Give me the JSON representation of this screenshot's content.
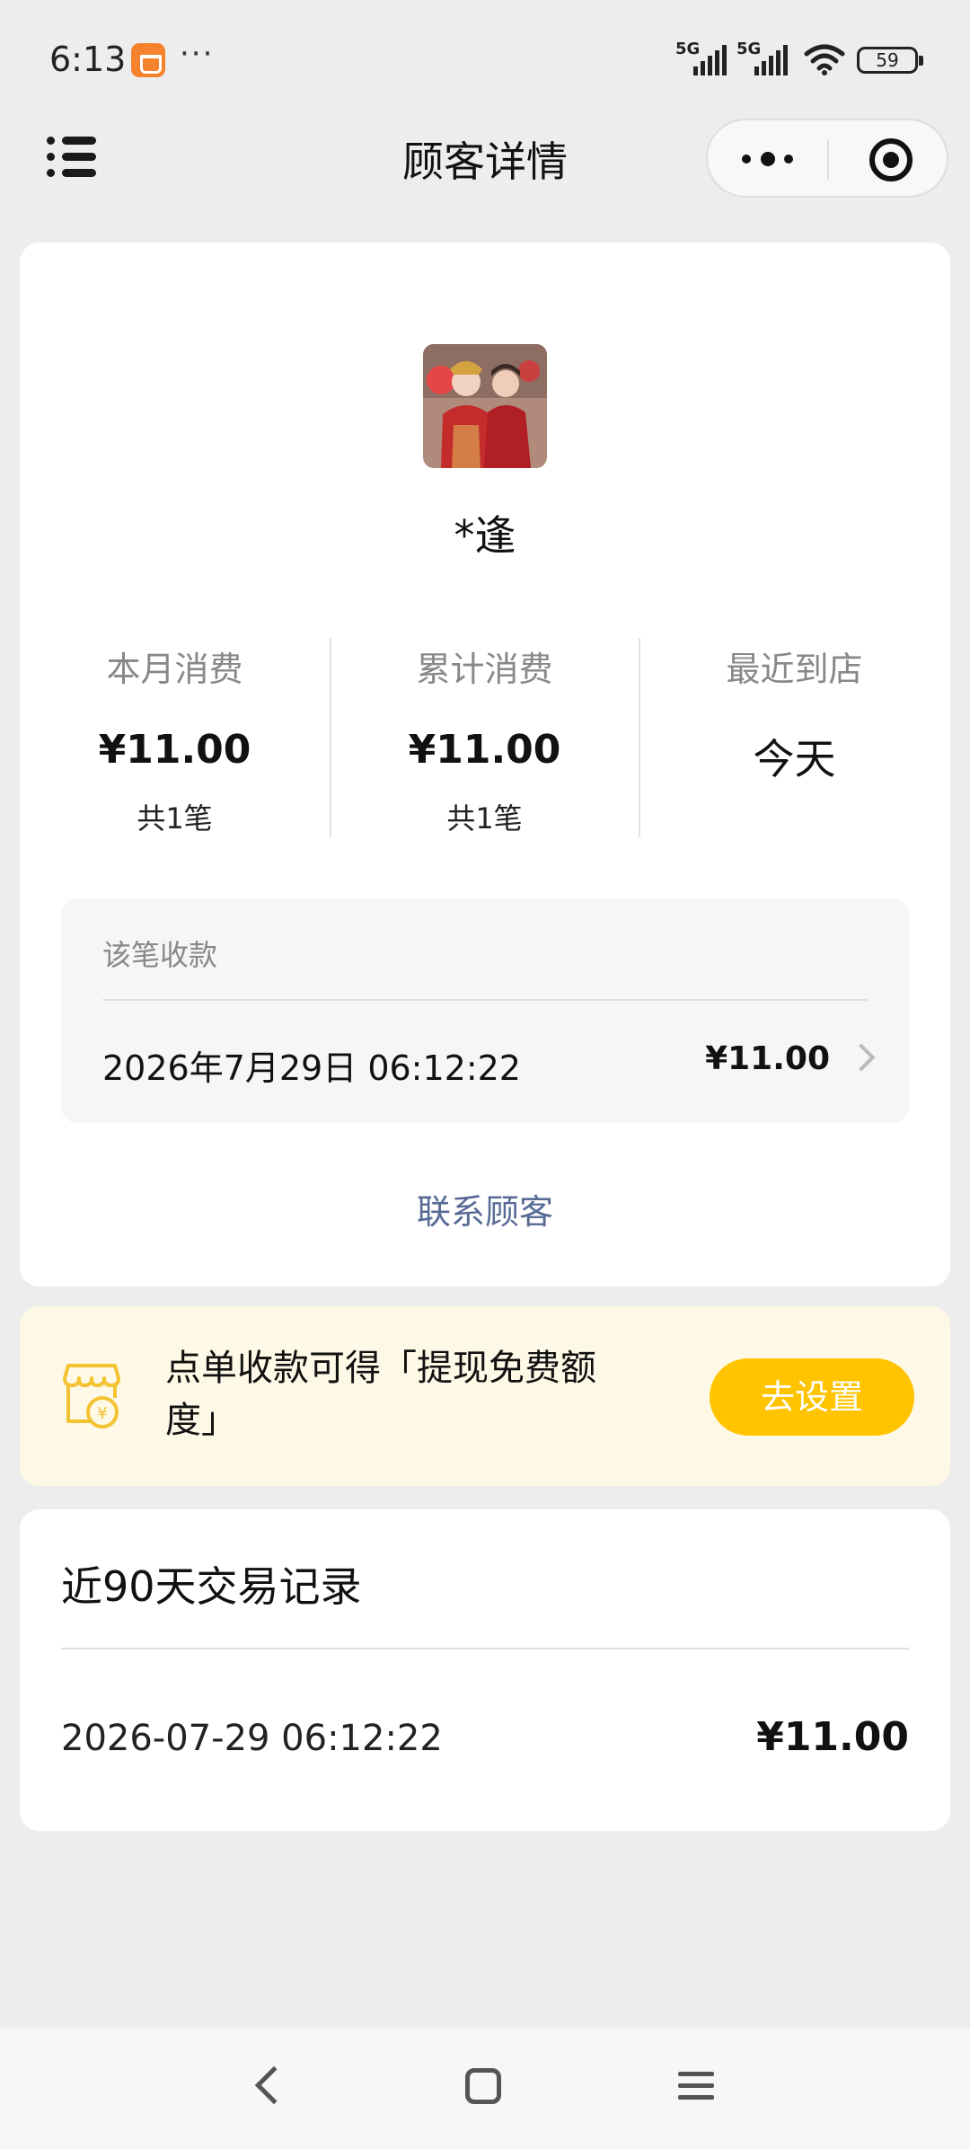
{
  "status_bar": {
    "time": "6:13",
    "dots": "···",
    "signal1": "5G",
    "signal2": "5G",
    "battery": "59"
  },
  "header": {
    "title": "顾客详情"
  },
  "profile": {
    "name": "*逢"
  },
  "stats": {
    "monthly": {
      "label": "本月消费",
      "value": "¥11.00",
      "count": "共1笔"
    },
    "total": {
      "label": "累计消费",
      "value": "¥11.00",
      "count": "共1笔"
    },
    "recent": {
      "label": "最近到店",
      "value": "今天"
    }
  },
  "receipt": {
    "label": "该笔收款",
    "date": "2026年7月29日 06:12:22",
    "amount": "¥11.00"
  },
  "contact_label": "联系顾客",
  "promo": {
    "text": "点单收款可得「提现免费额度」",
    "button": "去设置"
  },
  "records": {
    "title": "近90天交易记录",
    "items": [
      {
        "date": "2026-07-29 06:12:22",
        "amount": "¥11.00"
      }
    ]
  },
  "colors": {
    "link": "#576b95",
    "accent": "#ffc300",
    "promo_bg": "#fef9e6"
  }
}
